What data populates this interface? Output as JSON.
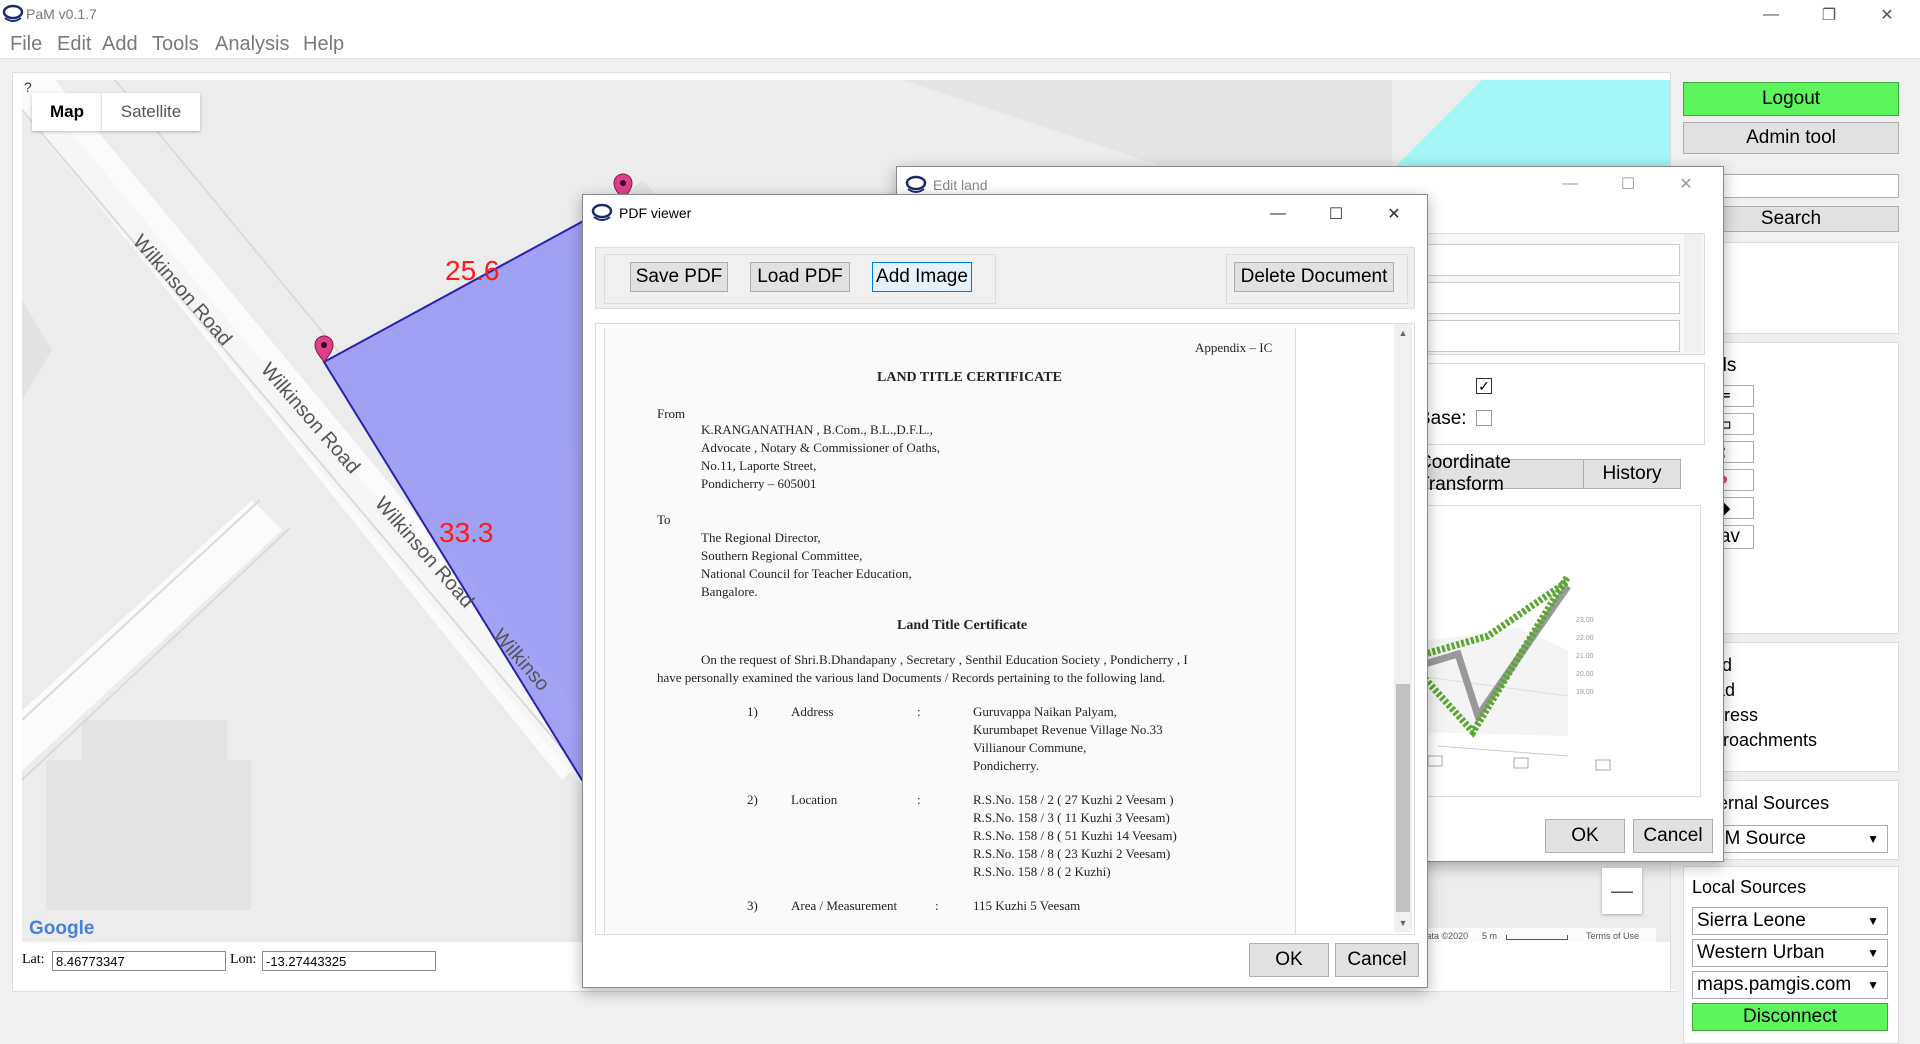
{
  "app": {
    "title": "PaM v0.1.7"
  },
  "menu": [
    "File",
    "Edit",
    "Add",
    "Tools",
    "Analysis",
    "Help"
  ],
  "map": {
    "tabs": [
      "Map",
      "Satellite"
    ],
    "road_labels": [
      "Wilkinson Road",
      "Wilkinson Road",
      "Wilkinson Road",
      "Wilkinso"
    ],
    "edge_lengths": [
      "25.6",
      "33.3"
    ],
    "corner_text": "?",
    "attribution": "Google",
    "data_credit": "Data ©2020",
    "scale": "5 m",
    "terms": "Terms of Use",
    "zoom_out": "—",
    "lat_label": "Lat:",
    "lat_value": "8.46773347",
    "lon_label": "Lon:",
    "lon_value": "-13.27443325"
  },
  "right_panel": {
    "logout": "Logout",
    "admin_tool": "Admin tool",
    "search": "Search",
    "tools_heading": "Tools",
    "nav_label": "Nav",
    "layers": [
      "Land",
      "Road",
      "Address",
      "Encroachments"
    ],
    "external_sources": "External Sources",
    "osm_source": "OSM Source",
    "local_sources": "Local Sources",
    "country": "Sierra Leone",
    "region": "Western Urban",
    "server": "maps.pamgis.com",
    "disconnect": "Disconnect"
  },
  "edit_land": {
    "title": "Edit land",
    "base_label": "Base:",
    "coordinate_transform": "Coordinate Transform",
    "history": "History",
    "ok": "OK",
    "cancel": "Cancel",
    "chart_ticks": [
      "23.00",
      "22.00",
      "21.00",
      "20.00",
      "19.00"
    ]
  },
  "pdf_viewer": {
    "title": "PDF viewer",
    "save_pdf": "Save PDF",
    "load_pdf": "Load PDF",
    "add_image": "Add Image",
    "delete_document": "Delete Document",
    "ok": "OK",
    "cancel": "Cancel",
    "document": {
      "appendix": "Appendix – IC",
      "heading": "LAND TITLE CERTIFICATE",
      "from_label": "From",
      "from_lines": [
        "K.RANGANATHAN , B.Com., B.L.,D.F.L.,",
        "Advocate , Notary & Commissioner of Oaths,",
        "No.11, Laporte Street,",
        "Pondicherry – 605001"
      ],
      "to_label": "To",
      "to_lines": [
        "The Regional Director,",
        "Southern Regional Committee,",
        "National Council for Teacher Education,",
        "Bangalore."
      ],
      "subheading": "Land Title Certificate",
      "para1": "On the request of Shri.B.Dhandapany , Secretary , Senthil Education Society , Pondicherry , I",
      "para2": "have personally examined the various land Documents / Records pertaining to the following land.",
      "items": [
        {
          "num": "1)",
          "label": "Address",
          "sep": ":",
          "lines": [
            "Guruvappa Naikan Palyam,",
            "Kurumbapet Revenue Village No.33",
            "Villianour Commune,",
            "Pondicherry."
          ]
        },
        {
          "num": "2)",
          "label": "Location",
          "sep": ":",
          "lines": [
            "R.S.No. 158 / 2 ( 27 Kuzhi 2 Veesam )",
            "R.S.No. 158 / 3 ( 11 Kuzhi 3 Veesam)",
            "R.S.No. 158 / 8 ( 51 Kuzhi 14 Veesam)",
            "R.S.No. 158 / 8  ( 23 Kuzhi 2 Veesam)",
            "R.S.No. 158 / 8 ( 2 Kuzhi)"
          ]
        },
        {
          "num": "3)",
          "label": "Area / Measurement",
          "sep": ":",
          "lines": [
            "115 Kuzhi 5 Veesam"
          ]
        }
      ]
    }
  },
  "colors": {
    "polygon": "#9999f5",
    "polygon_edge": "#2a1fb0",
    "pin": "#e0408a",
    "edge_label": "#ff1a1a",
    "water": "#a4f5f5",
    "green_button": "#5cf55c",
    "chart_green": "#5aa832"
  }
}
